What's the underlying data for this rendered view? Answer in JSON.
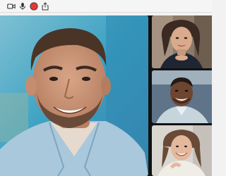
{
  "toolbar": {
    "buttons": [
      {
        "icon": "video-camera-icon"
      },
      {
        "icon": "microphone-icon"
      },
      {
        "icon": "record-icon",
        "color": "#e53935"
      },
      {
        "icon": "share-icon"
      }
    ]
  },
  "participants": {
    "main": {
      "name": ""
    },
    "tiles": [
      {
        "name": ""
      },
      {
        "name": ""
      },
      {
        "name": ""
      }
    ]
  },
  "colors": {
    "record": "#e53935",
    "stage": "#121212",
    "toolbar": "#f5f5f5"
  }
}
